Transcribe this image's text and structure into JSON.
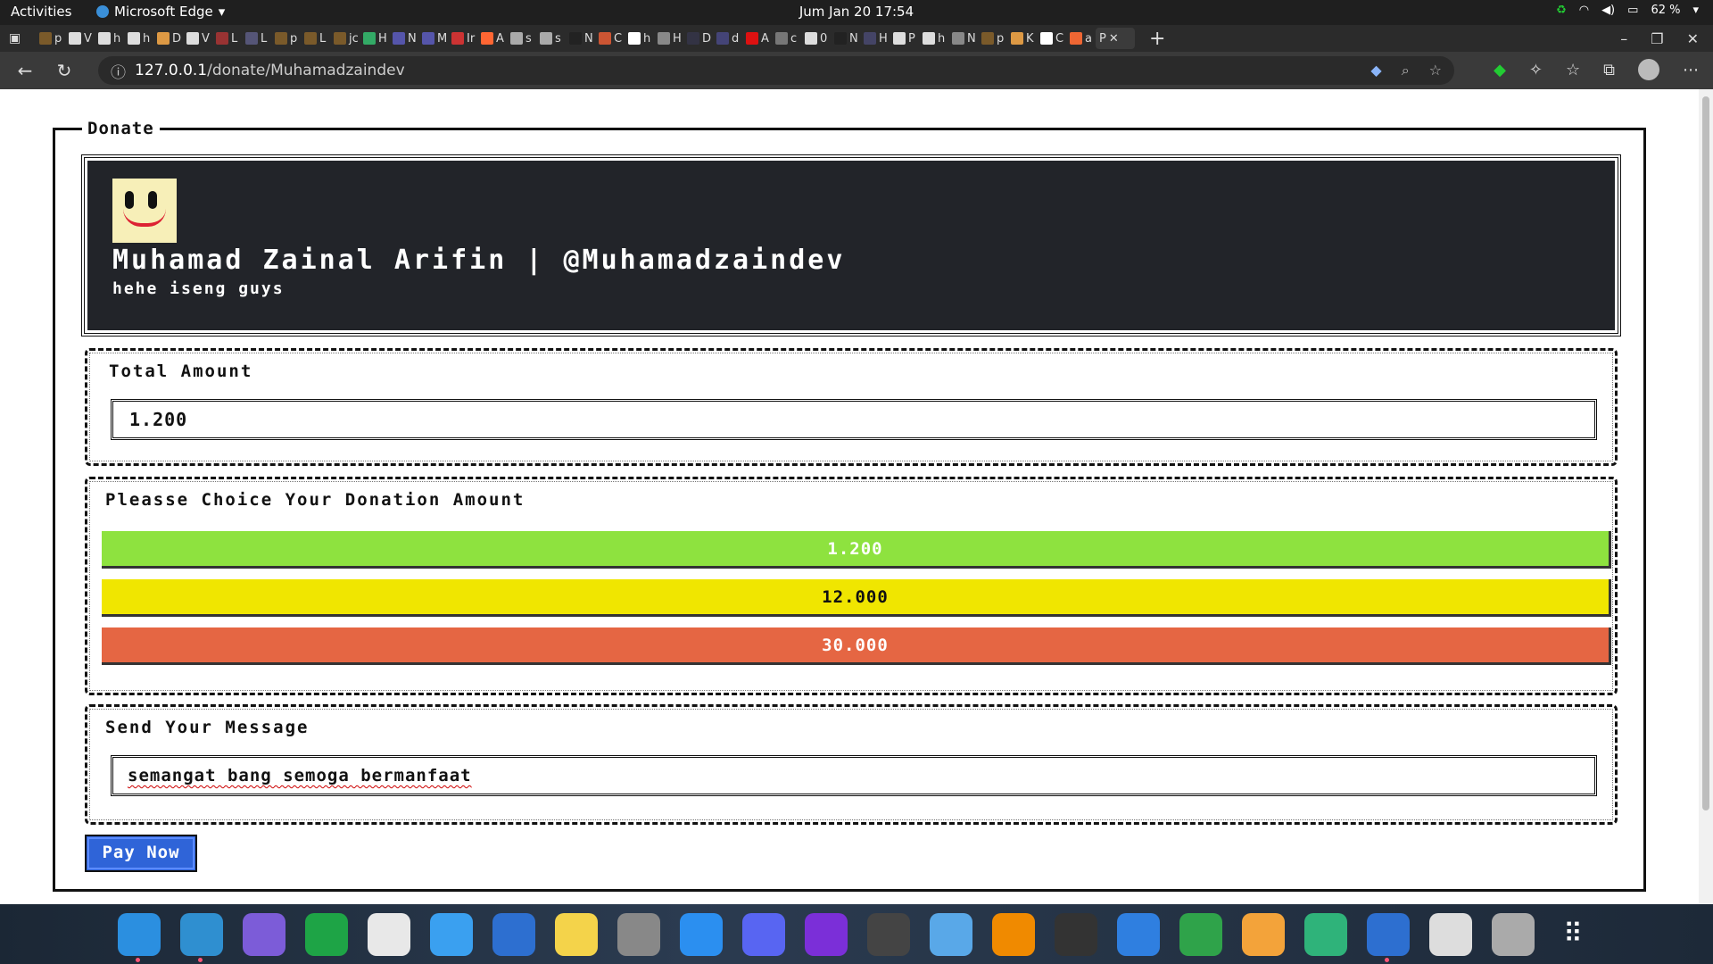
{
  "system": {
    "activities": "Activities",
    "app_menu": "Microsoft Edge",
    "clock": "Jum Jan 20  17:54",
    "battery": "62 %"
  },
  "browser": {
    "tabs": [
      {
        "label": "p",
        "color": "#7a5a2a"
      },
      {
        "label": "V",
        "color": "#ddd"
      },
      {
        "label": "h",
        "color": "#ddd"
      },
      {
        "label": "h",
        "color": "#ddd"
      },
      {
        "label": "D",
        "color": "#d94"
      },
      {
        "label": "V",
        "color": "#ddd"
      },
      {
        "label": "L",
        "color": "#933"
      },
      {
        "label": "L",
        "color": "#557"
      },
      {
        "label": "p",
        "color": "#7a5a2a"
      },
      {
        "label": "L",
        "color": "#7a5a2a"
      },
      {
        "label": "jc",
        "color": "#7a5a2a"
      },
      {
        "label": "H",
        "color": "#3a6"
      },
      {
        "label": "N",
        "color": "#55a"
      },
      {
        "label": "M",
        "color": "#55a"
      },
      {
        "label": "Ir",
        "color": "#c33"
      },
      {
        "label": "A",
        "color": "#f63"
      },
      {
        "label": "s",
        "color": "#aaa"
      },
      {
        "label": "s",
        "color": "#aaa"
      },
      {
        "label": "N",
        "color": "#222"
      },
      {
        "label": "C",
        "color": "#c53"
      },
      {
        "label": "h",
        "color": "#fff"
      },
      {
        "label": "H",
        "color": "#888"
      },
      {
        "label": "D",
        "color": "#334"
      },
      {
        "label": "d",
        "color": "#447"
      },
      {
        "label": "A",
        "color": "#d11"
      },
      {
        "label": "c",
        "color": "#777"
      },
      {
        "label": "0",
        "color": "#ddd"
      },
      {
        "label": "N",
        "color": "#222"
      },
      {
        "label": "H",
        "color": "#446"
      },
      {
        "label": "P",
        "color": "#ddd"
      },
      {
        "label": "h",
        "color": "#ddd"
      },
      {
        "label": "N",
        "color": "#888"
      },
      {
        "label": "p",
        "color": "#7a5a2a"
      },
      {
        "label": "K",
        "color": "#d94"
      },
      {
        "label": "C",
        "color": "#fff"
      },
      {
        "label": "a",
        "color": "#e63"
      }
    ],
    "active_tab": "P",
    "url_host": "127.0.0.1",
    "url_path": "/donate/Muhamadzaindev"
  },
  "donate": {
    "legend": "Donate",
    "name": "Muhamad Zainal Arifin | @Muhamadzaindev",
    "bio": "hehe iseng guys",
    "total_label": "Total Amount",
    "total_value": "1.200",
    "choice_label": "Pleasse Choice Your Donation Amount",
    "options": [
      {
        "label": "1.200",
        "color": "#8ee23f"
      },
      {
        "label": "12.000",
        "color": "#f0e600"
      },
      {
        "label": "30.000",
        "color": "#e56643"
      }
    ],
    "message_label": "Send Your Message",
    "message_value": "semangat bang semoga bermanfaat",
    "pay_label": "Pay Now"
  },
  "dock": [
    {
      "name": "vscode",
      "color": "#2b8fe0",
      "running": true
    },
    {
      "name": "edge",
      "color": "#2f8fd0",
      "running": true
    },
    {
      "name": "app-purple",
      "color": "#7c5cd8",
      "running": false
    },
    {
      "name": "chat",
      "color": "#1ea446",
      "running": false
    },
    {
      "name": "app-white",
      "color": "#e8e8e8",
      "running": false
    },
    {
      "name": "finder",
      "color": "#3aa0f0",
      "running": false
    },
    {
      "name": "app-blue",
      "color": "#2d6fd0",
      "running": false
    },
    {
      "name": "notes",
      "color": "#f4d34a",
      "running": false
    },
    {
      "name": "settings",
      "color": "#888",
      "running": false
    },
    {
      "name": "app-store",
      "color": "#2b8ff0",
      "running": false
    },
    {
      "name": "discord",
      "color": "#5865f2",
      "running": false
    },
    {
      "name": "app-violet",
      "color": "#7b2fd8",
      "running": false
    },
    {
      "name": "preview",
      "color": "#444",
      "running": false
    },
    {
      "name": "files",
      "color": "#59a8e8",
      "running": false
    },
    {
      "name": "vlc",
      "color": "#f08a00",
      "running": false
    },
    {
      "name": "terminal",
      "color": "#333",
      "running": false
    },
    {
      "name": "keynote",
      "color": "#2f7fe0",
      "running": false
    },
    {
      "name": "numbers",
      "color": "#2fa34a",
      "running": false
    },
    {
      "name": "pages",
      "color": "#f3a33a",
      "running": false
    },
    {
      "name": "app-green",
      "color": "#2fb37a",
      "running": false
    },
    {
      "name": "app-blue2",
      "color": "#2d6fd0",
      "running": true
    },
    {
      "name": "screenshot",
      "color": "#ddd",
      "running": false
    },
    {
      "name": "disk",
      "color": "#aaa",
      "running": false
    }
  ]
}
